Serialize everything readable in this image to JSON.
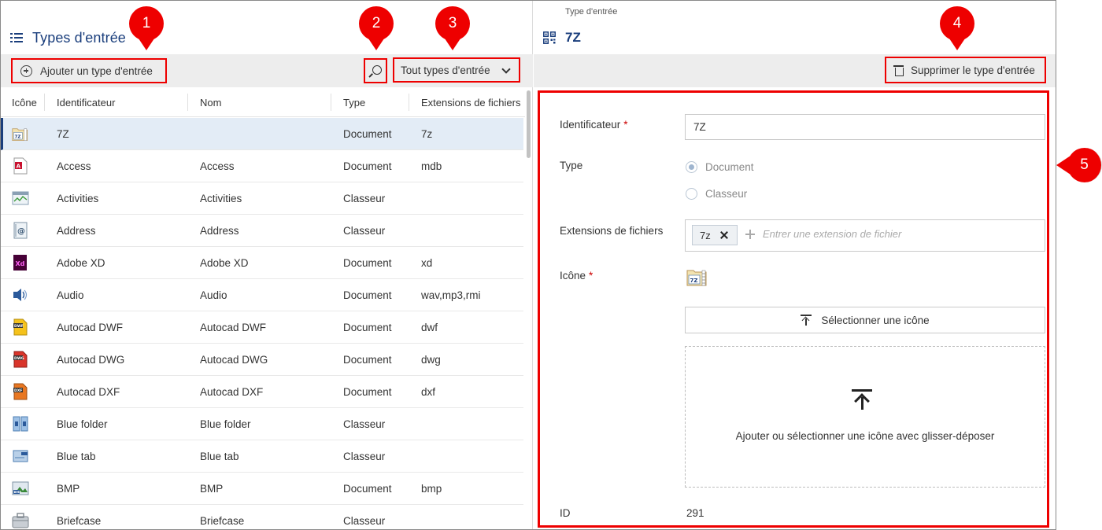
{
  "left": {
    "title": "Types d'entrée",
    "add_button": "Ajouter un type d'entrée",
    "filter_dropdown": "Tout types d'entrée",
    "columns": [
      "Icône",
      "Identificateur",
      "Nom",
      "Type",
      "Extensions de fichiers"
    ],
    "rows": [
      {
        "icon": "7z-archive-icon",
        "id": "7Z",
        "nom": "",
        "type": "Document",
        "ext": "7z",
        "selected": true
      },
      {
        "icon": "access-icon",
        "id": "Access",
        "nom": "Access",
        "type": "Document",
        "ext": "mdb"
      },
      {
        "icon": "activities-icon",
        "id": "Activities",
        "nom": "Activities",
        "type": "Classeur",
        "ext": ""
      },
      {
        "icon": "address-icon",
        "id": "Address",
        "nom": "Address",
        "type": "Classeur",
        "ext": ""
      },
      {
        "icon": "adobe-xd-icon",
        "id": "Adobe XD",
        "nom": "Adobe XD",
        "type": "Document",
        "ext": "xd"
      },
      {
        "icon": "audio-icon",
        "id": "Audio",
        "nom": "Audio",
        "type": "Document",
        "ext": "wav,mp3,rmi"
      },
      {
        "icon": "autocad-dwf-icon",
        "id": "Autocad DWF",
        "nom": "Autocad DWF",
        "type": "Document",
        "ext": "dwf"
      },
      {
        "icon": "autocad-dwg-icon",
        "id": "Autocad DWG",
        "nom": "Autocad DWG",
        "type": "Document",
        "ext": "dwg"
      },
      {
        "icon": "autocad-dxf-icon",
        "id": "Autocad DXF",
        "nom": "Autocad DXF",
        "type": "Document",
        "ext": "dxf"
      },
      {
        "icon": "blue-folder-icon",
        "id": "Blue folder",
        "nom": "Blue folder",
        "type": "Classeur",
        "ext": ""
      },
      {
        "icon": "blue-tab-icon",
        "id": "Blue tab",
        "nom": "Blue tab",
        "type": "Classeur",
        "ext": ""
      },
      {
        "icon": "bmp-icon",
        "id": "BMP",
        "nom": "BMP",
        "type": "Document",
        "ext": "bmp"
      },
      {
        "icon": "briefcase-icon",
        "id": "Briefcase",
        "nom": "Briefcase",
        "type": "Classeur",
        "ext": ""
      }
    ]
  },
  "right": {
    "subtitle": "Type d'entrée",
    "title": "7Z",
    "delete_button": "Supprimer le type d'entrée",
    "form": {
      "identifier_label": "Identificateur",
      "identifier_value": "7Z",
      "required_mark": "*",
      "type_label": "Type",
      "type_options": [
        "Document",
        "Classeur"
      ],
      "type_selected": "Document",
      "extensions_label": "Extensions de fichiers",
      "extension_chip": "7z",
      "extension_placeholder": "Entrer une extension de fichier",
      "icon_label": "Icône",
      "select_icon_button": "Sélectionner une icône",
      "drop_text": "Ajouter ou sélectionner une icône avec glisser-déposer",
      "id_label": "ID",
      "id_value": "291"
    }
  },
  "callouts": [
    "1",
    "2",
    "3",
    "4",
    "5"
  ],
  "colors": {
    "accent": "#1a3e7c",
    "annotation": "#e00000",
    "selected_row": "#e3ecf6",
    "toolbar": "#ededed"
  }
}
